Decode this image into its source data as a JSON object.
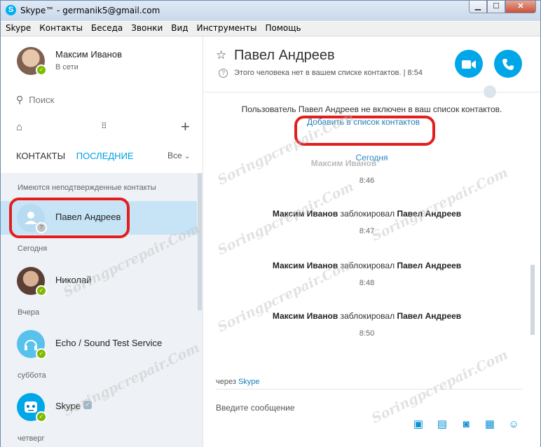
{
  "window": {
    "title": "Skype™ - germanik5@gmail.com",
    "app_icon": "S",
    "controls": {
      "minimize": "▁",
      "maximize": "☐",
      "close": "✕"
    }
  },
  "menu": [
    "Skype",
    "Контакты",
    "Беседа",
    "Звонки",
    "Вид",
    "Инструменты",
    "Помощь"
  ],
  "profile": {
    "name": "Максим Иванов",
    "status": "В сети"
  },
  "search": {
    "placeholder": "Поиск",
    "icon": "search-icon"
  },
  "toolbar": {
    "home_icon": "⌂",
    "dialpad_icon": "⠿",
    "add_icon": "+"
  },
  "tabs": {
    "contacts": "КОНТАКТЫ",
    "recent": "ПОСЛЕДНИЕ",
    "filter": "Все",
    "filter_chevron": "⌄"
  },
  "contact_list": {
    "section_unconfirmed": "Имеются неподтвержденные контакты",
    "contacts": [
      {
        "name": "Павел Андреев",
        "section": ""
      },
      {
        "name": "Николай",
        "section": "Сегодня"
      },
      {
        "name": "Echo / Sound Test Service",
        "section": "Вчера"
      },
      {
        "name": "Skype",
        "section": "суббота"
      }
    ],
    "last_section": "четверг"
  },
  "conversation": {
    "name": "Павел Андреев",
    "subtitle": "Этого человека нет в вашем списке контактов.  |  8:54",
    "notice": "Пользователь Павел Андреев не включен в ваш список контактов.",
    "add_link": "Добавить в список контактов",
    "day": "Сегодня",
    "ghost_text": "Максим Иванов",
    "first_time": "8:46",
    "events": [
      {
        "actor": "Максим Иванов",
        "verb": "заблокировал",
        "target": "Павел Андреев",
        "time": "8:47"
      },
      {
        "actor": "Максим Иванов",
        "verb": "заблокировал",
        "target": "Павел Андреев",
        "time": "8:48"
      },
      {
        "actor": "Максим Иванов",
        "verb": "заблокировал",
        "target": "Павел Андреев",
        "time": "8:50"
      }
    ],
    "via_prefix": "через",
    "via_link": "Skype",
    "compose_placeholder": "Введите сообщение"
  },
  "watermark": "Soringpcrepair.Com",
  "colors": {
    "accent": "#00a7e8",
    "online": "#7fba00",
    "highlight": "#c6e4f6",
    "annotation": "#e21e1e"
  }
}
